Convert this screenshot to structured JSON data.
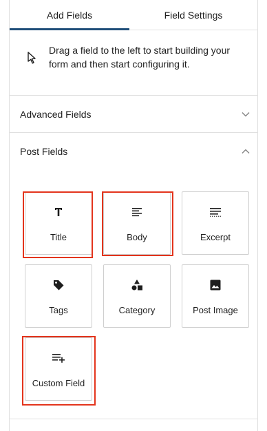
{
  "tabs": {
    "add_fields": "Add Fields",
    "field_settings": "Field Settings"
  },
  "hint": {
    "icon": "cursor-arrow-icon",
    "text": "Drag a field to the left to start building your form and then start configuring it."
  },
  "sections": {
    "advanced": {
      "label": "Advanced Fields",
      "state": "collapsed"
    },
    "post": {
      "label": "Post Fields",
      "state": "expanded"
    }
  },
  "post_fields": [
    {
      "label": "Title",
      "icon": "title-icon",
      "highlighted": true
    },
    {
      "label": "Body",
      "icon": "body-text-icon",
      "highlighted": true
    },
    {
      "label": "Excerpt",
      "icon": "excerpt-icon",
      "highlighted": false
    },
    {
      "label": "Tags",
      "icon": "tag-icon",
      "highlighted": false
    },
    {
      "label": "Category",
      "icon": "category-icon",
      "highlighted": false
    },
    {
      "label": "Post Image",
      "icon": "image-icon",
      "highlighted": false
    },
    {
      "label": "Custom Field",
      "icon": "custom-field-icon",
      "highlighted": true
    }
  ],
  "colors": {
    "tab_active_underline": "#1f4e79",
    "highlight": "#e3341c",
    "border": "#cfcfcf"
  }
}
